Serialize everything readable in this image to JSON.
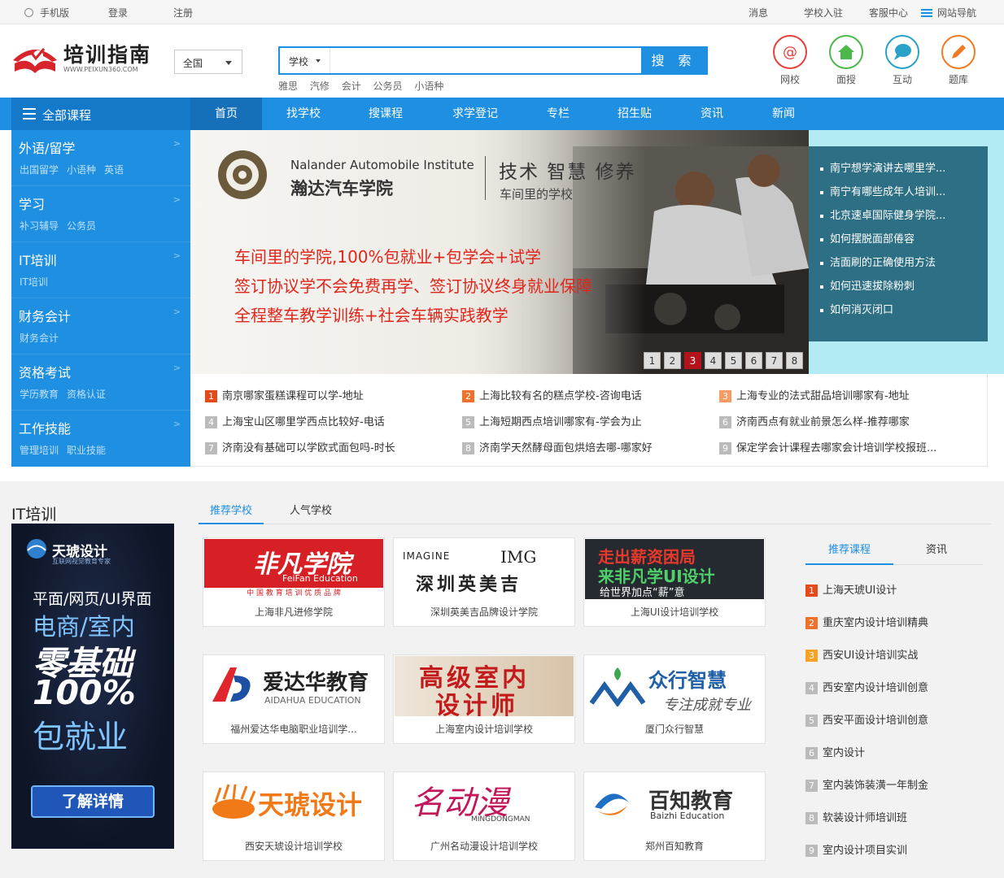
{
  "topbar": {
    "mobile": "手机版",
    "login": "登录",
    "register": "注册",
    "messages": "消息",
    "school_join": "学校入驻",
    "service": "客服中心",
    "sitemap": "网站导航"
  },
  "logo": {
    "name": "培训指南",
    "domain": "WWW.PEIXUN360.COM"
  },
  "region": {
    "selected": "全国"
  },
  "search": {
    "category": "学校",
    "value": "",
    "placeholder": "",
    "button": "搜 索",
    "hot": [
      "雅思",
      "汽修",
      "会计",
      "公务员",
      "小语种"
    ]
  },
  "quick_links": [
    {
      "label": "网校",
      "icon": "at-icon",
      "color": "#e8413b"
    },
    {
      "label": "面授",
      "icon": "home-icon",
      "color": "#4cb849"
    },
    {
      "label": "互动",
      "icon": "chat-icon",
      "color": "#2aa2c8"
    },
    {
      "label": "题库",
      "icon": "pencil-icon",
      "color": "#f07a24"
    }
  ],
  "nav": {
    "all_courses": "全部课程",
    "items": [
      "首页",
      "找学校",
      "搜课程",
      "求学登记",
      "专栏",
      "招生贴",
      "资讯",
      "新闻"
    ]
  },
  "sidebar": [
    {
      "title": "外语/留学",
      "subs": [
        "出国留学",
        "小语种",
        "英语"
      ]
    },
    {
      "title": "学习",
      "subs": [
        "补习辅导",
        "公务员"
      ]
    },
    {
      "title": "IT培训",
      "subs": [
        "IT培训"
      ]
    },
    {
      "title": "财务会计",
      "subs": [
        "财务会计"
      ]
    },
    {
      "title": "资格考试",
      "subs": [
        "学历教育",
        "资格认证"
      ]
    },
    {
      "title": "工作技能",
      "subs": [
        "管理培训",
        "职业技能"
      ]
    }
  ],
  "banner": {
    "school_en": "Nalander Automobile Institute",
    "school_cn": "瀚达汽车学院",
    "slogan": "技术 智慧 修养",
    "sub": "车间里的学校",
    "lines": [
      "车间里的学院,100%包就业+包学会+试学",
      "签订协议学不会免费再学、签订协议终身就业保障",
      "全程整车教学训练+社会车辆实践教学"
    ],
    "pages": [
      "1",
      "2",
      "3",
      "4",
      "5",
      "6",
      "7",
      "8"
    ],
    "current_page": "3"
  },
  "right_news": [
    "南宁想学演讲去哪里学...",
    "南宁有哪些成年人培训...",
    "北京速卓国际健身学院...",
    "如何摆脱面部倦容",
    "洁面刷的正确使用方法",
    "如何迅速拔除粉刺",
    "如何消灭闭口"
  ],
  "numbered_news": [
    {
      "n": "1",
      "text": "南京哪家蛋糕课程可以学-地址"
    },
    {
      "n": "2",
      "text": "上海比较有名的糕点学校-咨询电话"
    },
    {
      "n": "3",
      "text": "上海专业的法式甜品培训哪家有-地址"
    },
    {
      "n": "4",
      "text": "上海宝山区哪里学西点比较好-电话"
    },
    {
      "n": "5",
      "text": "上海短期西点培训哪家有-学会为止"
    },
    {
      "n": "6",
      "text": "济南西点有就业前景怎么样-推荐哪家"
    },
    {
      "n": "7",
      "text": "济南没有基础可以学欧式面包吗-时长"
    },
    {
      "n": "8",
      "text": "济南学天然酵母面包烘焙去哪-哪家好"
    },
    {
      "n": "9",
      "text": "保定学会计课程去哪家会计培训学校报班..."
    }
  ],
  "it_section": {
    "title": "IT培训",
    "tabs": [
      "推荐学校",
      "人气学校"
    ],
    "ad": {
      "brand": "天琥设计",
      "brand_sub": "互联网视觉教育专家",
      "line1": "平面/网页/UI界面",
      "line2": "电商/室内",
      "line3": "零基础",
      "line4": "100%",
      "line5": "包就业",
      "button": "了解详情"
    },
    "schools": [
      {
        "name": "上海非凡进修学院",
        "logo_text": "非凡学院",
        "logo_sub": "FeiFan Education",
        "logo_foot": "中 国 教 育 培 训 优 质 品 牌"
      },
      {
        "name": "深圳英美吉品牌设计学院",
        "logo_text": "深圳英美吉",
        "logo_sub": "IMAGINE",
        "logo_foot": "IMG"
      },
      {
        "name": "上海UI设计培训学校",
        "logo_text": "走出薪资困局",
        "logo_sub": "来非凡学UI设计",
        "logo_foot": "给世界加点“薪”意"
      },
      {
        "name": "福州爱达华电脑职业培训学...",
        "logo_text": "爱达华教育",
        "logo_sub": "AIDAHUA EDUCATION",
        "logo_foot": ""
      },
      {
        "name": "上海室内设计培训学校",
        "logo_text": "高级室内",
        "logo_sub": "设计师",
        "logo_foot": ""
      },
      {
        "name": "厦门众行智慧",
        "logo_text": "众行智慧",
        "logo_sub": "专注成就专业",
        "logo_foot": ""
      },
      {
        "name": "西安天琥设计培训学校",
        "logo_text": "天琥设计",
        "logo_sub": "",
        "logo_foot": ""
      },
      {
        "name": "广州名动漫设计培训学校",
        "logo_text": "名动漫",
        "logo_sub": "MINGDONGMAN",
        "logo_foot": ""
      },
      {
        "name": "郑州百知教育",
        "logo_text": "百知教育",
        "logo_sub": "Baizhi Education",
        "logo_foot": ""
      }
    ],
    "right_tabs": [
      "推荐课程",
      "资讯"
    ],
    "courses": [
      {
        "n": "1",
        "text": "上海天琥UI设计"
      },
      {
        "n": "2",
        "text": "重庆室内设计培训精典"
      },
      {
        "n": "3",
        "text": "西安UI设计培训实战"
      },
      {
        "n": "4",
        "text": "西安室内设计培训创意"
      },
      {
        "n": "5",
        "text": "西安平面设计培训创意"
      },
      {
        "n": "6",
        "text": "室内设计"
      },
      {
        "n": "7",
        "text": "室内装饰装潢一年制金"
      },
      {
        "n": "8",
        "text": "软装设计师培训班"
      },
      {
        "n": "9",
        "text": "室内设计项目实训"
      }
    ]
  }
}
